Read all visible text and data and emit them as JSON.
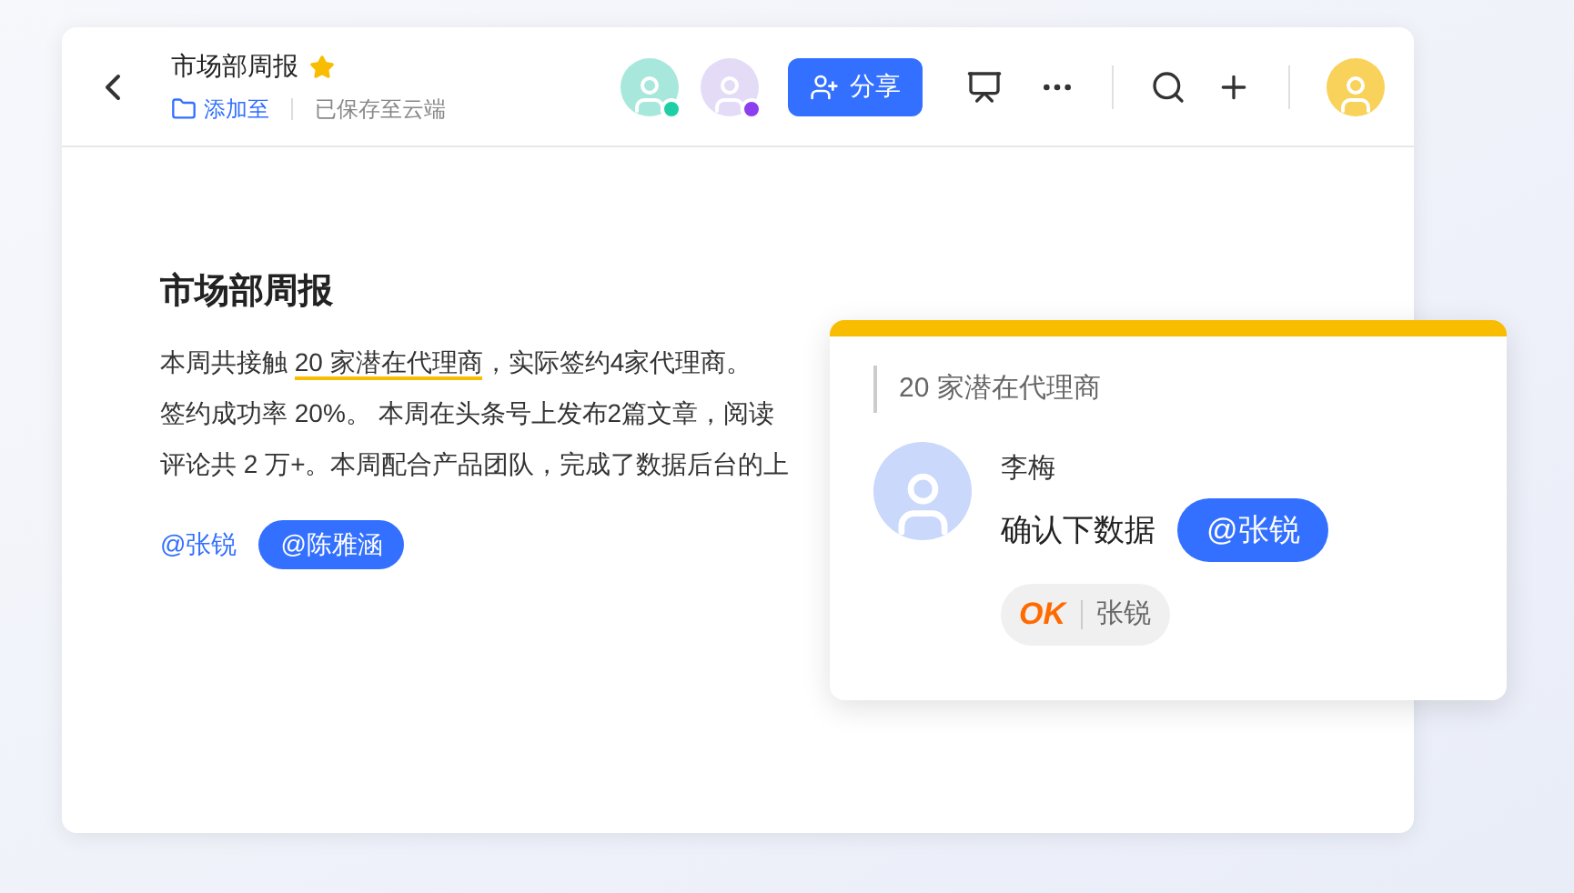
{
  "header": {
    "title": "市场部周报",
    "starred": true,
    "add_to": "添加至",
    "save_status": "已保存至云端",
    "collaborators": [
      {
        "color": "#1ecfa6"
      },
      {
        "color": "#8b3ff0"
      }
    ],
    "share_button": "分享"
  },
  "document": {
    "heading": "市场部周报",
    "lines": [
      {
        "before": "本周共接触 ",
        "highlight": "20 家潜在代理商",
        "after": "，实际签约4家代理商。"
      },
      {
        "before": "签约成功率 20%。 本周在头条号上发布2篇文章，阅读"
      },
      {
        "before": "评论共 2 万+。本周配合产品团队，完成了数据后台的上"
      }
    ],
    "mentions": [
      {
        "label": "@张锐",
        "selected": false
      },
      {
        "label": "@陈雅涵",
        "selected": true
      }
    ]
  },
  "comment": {
    "quote": "20 家潜在代理商",
    "author": "李梅",
    "text": "确认下数据",
    "mention": "@张锐",
    "reaction": {
      "sticker": "OK",
      "user": "张锐"
    }
  }
}
